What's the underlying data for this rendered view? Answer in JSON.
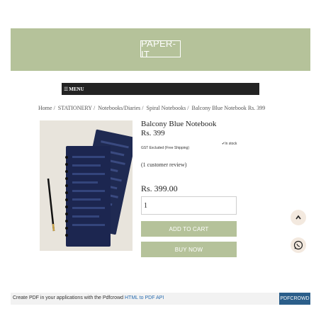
{
  "header": {
    "logo_text": "PAPER-IT"
  },
  "menu": {
    "label": "MENU",
    "icon": "hamburger-icon"
  },
  "breadcrumb": [
    "Home",
    "STATIONERY",
    "Notebooks/Diaries",
    "Spiral Notebooks",
    "Balcony Blue Notebook Rs. 399"
  ],
  "product": {
    "title": "Balcony Blue Notebook",
    "price_short": "Rs. 399",
    "gst_note": "GST Excluded (Free Shipping)",
    "stock": "In stock",
    "reviews": "(1 customer review)",
    "price": "Rs. 399.00",
    "quantity": "1"
  },
  "buttons": {
    "add_to_cart": "ADD TO CART",
    "buy_now": "BUY NOW"
  },
  "floating": {
    "scroll_top_icon": "chevron-up-icon",
    "whatsapp_icon": "whatsapp-icon"
  },
  "footer": {
    "text": "Create PDF in your applications with the Pdfcrowd",
    "link": "HTML to PDF API",
    "button": "PDFCROWD"
  },
  "colors": {
    "accent": "#b5c29a",
    "menu_bg": "#232323",
    "notebook": "#1f2a52",
    "footer_btn": "#2b5e8a"
  }
}
